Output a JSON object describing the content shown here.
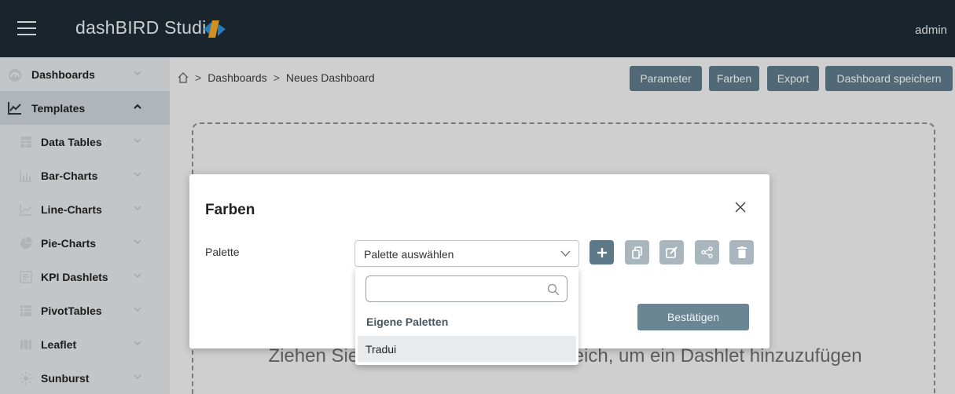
{
  "header": {
    "app_title": "dashBIRD Studio",
    "user": "admin"
  },
  "sidebar": {
    "items": [
      {
        "label": "Dashboards",
        "icon": "dashboard-icon",
        "expanded": false
      },
      {
        "label": "Templates",
        "icon": "line-chart-icon",
        "expanded": true
      },
      {
        "label": "Data Tables",
        "icon": "table-icon",
        "expanded": false
      },
      {
        "label": "Bar-Charts",
        "icon": "bar-chart-icon",
        "expanded": false
      },
      {
        "label": "Line-Charts",
        "icon": "line-chart-icon",
        "expanded": false
      },
      {
        "label": "Pie-Charts",
        "icon": "pie-chart-icon",
        "expanded": false
      },
      {
        "label": "KPI Dashlets",
        "icon": "kpi-icon",
        "expanded": false
      },
      {
        "label": "PivotTables",
        "icon": "pivot-table-icon",
        "expanded": false
      },
      {
        "label": "Leaflet",
        "icon": "map-icon",
        "expanded": false
      },
      {
        "label": "Sunburst",
        "icon": "sunburst-icon",
        "expanded": false
      }
    ]
  },
  "breadcrumb": {
    "items": [
      "Dashboards",
      "Neues Dashboard"
    ]
  },
  "toolbar": {
    "parameter": "Parameter",
    "farben": "Farben",
    "export": "Export",
    "save": "Dashboard speichern"
  },
  "main": {
    "dropzone_text": "Ziehen Sie ein Dashlet in diesen Bereich, um ein Dashlet hinzuzufügen"
  },
  "modal": {
    "title": "Farben",
    "palette_label": "Palette",
    "select_value": "Palette auswählen",
    "confirm_label": "Bestätigen"
  },
  "dropdown": {
    "search_value": "",
    "group_label": "Eigene Paletten",
    "options": [
      "Tradui"
    ]
  },
  "colors": {
    "topbar": "#1d2a33",
    "accent": "#5d7887",
    "sidebar": "#dfe2e4"
  }
}
